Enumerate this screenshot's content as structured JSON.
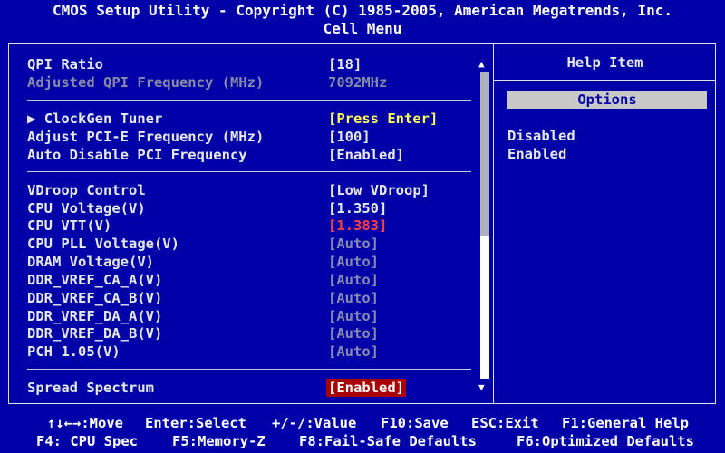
{
  "header": {
    "title": "CMOS Setup Utility - Copyright (C) 1985-2005, American Megatrends, Inc.",
    "menu": "Cell Menu"
  },
  "settings": {
    "qpi_ratio": {
      "label": "QPI Ratio",
      "value": "[18]"
    },
    "adj_qpi": {
      "label": "Adjusted QPI Frequency (MHz)",
      "value": "7092MHz"
    },
    "clockgen": {
      "label": "ClockGen Tuner",
      "value": "[Press Enter]"
    },
    "pcie_freq": {
      "label": "Adjust PCI-E Frequency (MHz)",
      "value": "[100]"
    },
    "auto_pci": {
      "label": "Auto Disable PCI Frequency",
      "value": "[Enabled]"
    },
    "vdroop": {
      "label": "VDroop Control",
      "value": "[Low VDroop]"
    },
    "cpu_voltage": {
      "label": "CPU Voltage(V)",
      "value": "[1.350]"
    },
    "cpu_vtt": {
      "label": "CPU VTT(V)",
      "value": "[1.383]"
    },
    "cpu_pll": {
      "label": "CPU PLL Voltage(V)",
      "value": "[Auto]"
    },
    "dram_voltage": {
      "label": "DRAM Voltage(V)",
      "value": "[Auto]"
    },
    "ddr_ca_a": {
      "label": "DDR_VREF_CA_A(V)",
      "value": "[Auto]"
    },
    "ddr_ca_b": {
      "label": "DDR_VREF_CA_B(V)",
      "value": "[Auto]"
    },
    "ddr_da_a": {
      "label": "DDR_VREF_DA_A(V)",
      "value": "[Auto]"
    },
    "ddr_da_b": {
      "label": "DDR_VREF_DA_B(V)",
      "value": "[Auto]"
    },
    "pch": {
      "label": "PCH 1.05(V)",
      "value": "[Auto]"
    },
    "spread": {
      "label": "Spread Spectrum",
      "value": "[Enabled]"
    }
  },
  "submenu_marker": "▶",
  "scrollbar": {
    "up": "▲",
    "down": "▼"
  },
  "help": {
    "title": "Help Item",
    "options_label": "Options",
    "options": [
      "Disabled",
      "Enabled"
    ]
  },
  "footer": {
    "move": "↑↓←→:Move",
    "select": "Enter:Select",
    "value": "+/-/:Value",
    "save": "F10:Save",
    "exit": "ESC:Exit",
    "general_help": "F1:General Help",
    "cpu_spec": "F4: CPU Spec",
    "memory_z": "F5:Memory-Z",
    "failsafe": "F8:Fail-Safe Defaults",
    "optimized": "F6:Optimized Defaults"
  },
  "colors": {
    "background": "#0000a8",
    "highlight": "#a80000",
    "value_yellow": "#ffff55",
    "warning_red": "#ff4040"
  }
}
